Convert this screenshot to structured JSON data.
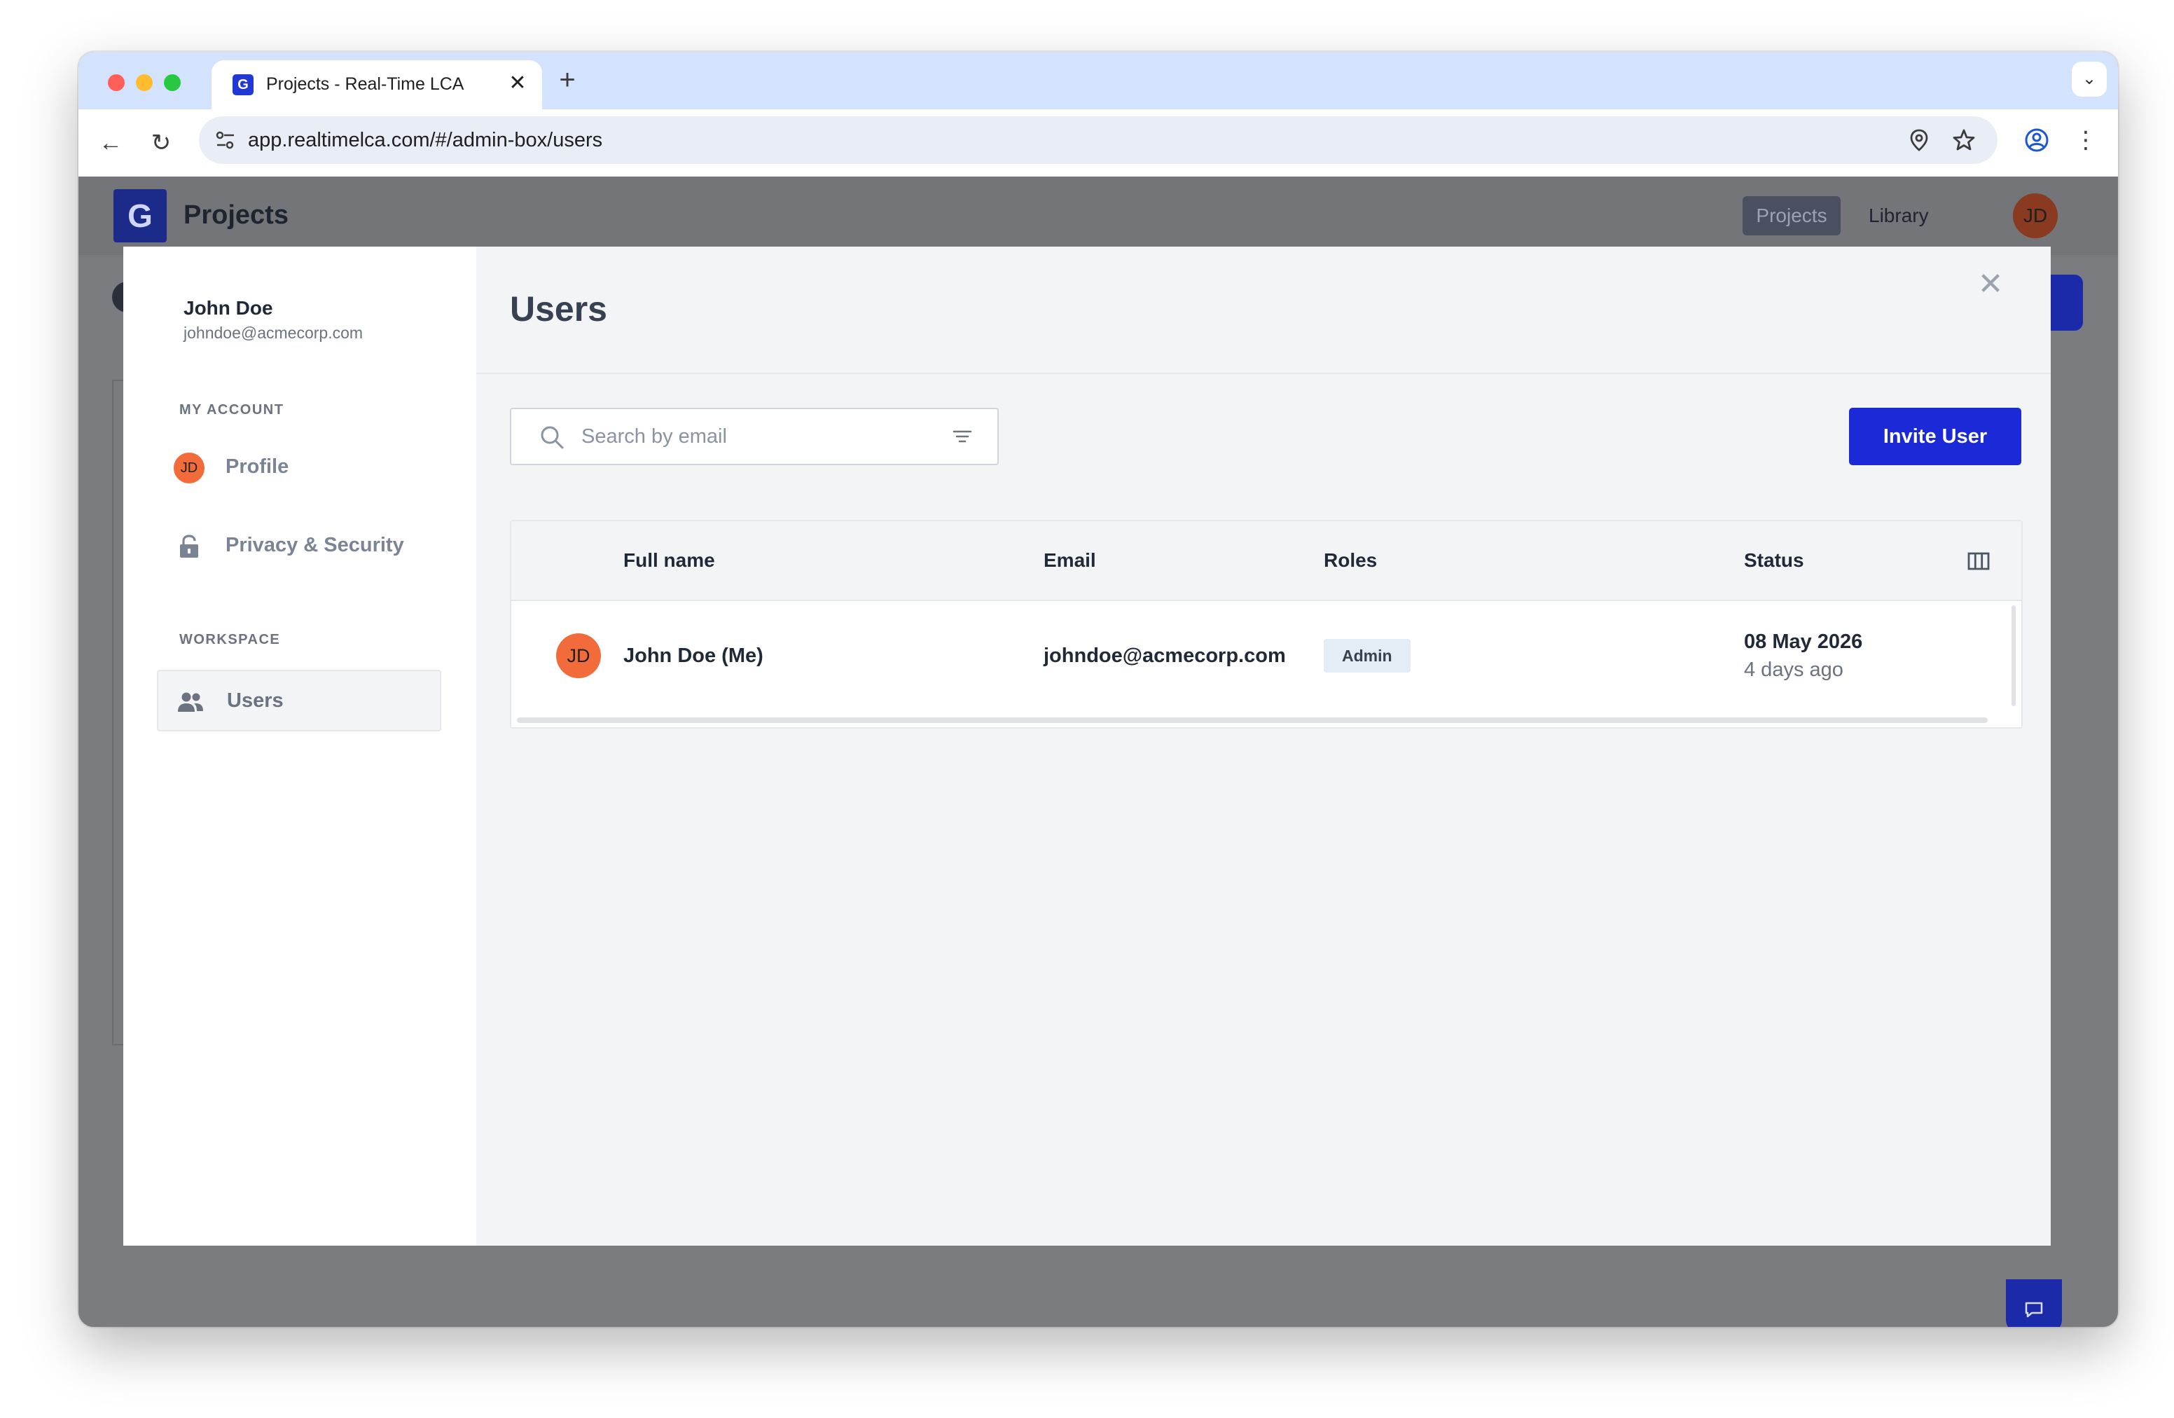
{
  "browser": {
    "tab_title": "Projects - Real-Time LCA",
    "tab_close": "✕",
    "new_tab": "+",
    "tab_menu": "⌄",
    "url": "app.realtimelca.com/#/admin-box/users",
    "back": "←",
    "reload": "↻",
    "more": "⋮"
  },
  "app": {
    "title": "Projects",
    "logo": "G",
    "nav": {
      "projects": "Projects",
      "library": "Library"
    },
    "avatar_initials": "JD"
  },
  "account": {
    "name": "John Doe",
    "email": "johndoe@acmecorp.com"
  },
  "sidebar": {
    "my_account_label": "MY ACCOUNT",
    "workspace_label": "WORKSPACE",
    "items": [
      {
        "label": "Profile",
        "icon": "avatar",
        "initials": "JD"
      },
      {
        "label": "Privacy & Security",
        "icon": "lock-icon"
      },
      {
        "label": "Users",
        "icon": "people-icon",
        "selected": true
      }
    ]
  },
  "main": {
    "title": "Users",
    "close": "✕",
    "search": {
      "placeholder": "Search by email",
      "value": ""
    },
    "invite_button": "Invite User",
    "table": {
      "columns": [
        "Full name",
        "Email",
        "Roles",
        "Status"
      ],
      "rows": [
        {
          "initials": "JD",
          "full_name": "John Doe (Me)",
          "email": "johndoe@acmecorp.com",
          "role": "Admin",
          "status_date": "08 May 2026",
          "status_relative": "4 days ago"
        }
      ]
    }
  },
  "colors": {
    "accent": "#1b2ad6",
    "avatar": "#f26b3a",
    "overlay": "#7a7c80",
    "badge_bg": "#e4ecf5"
  }
}
